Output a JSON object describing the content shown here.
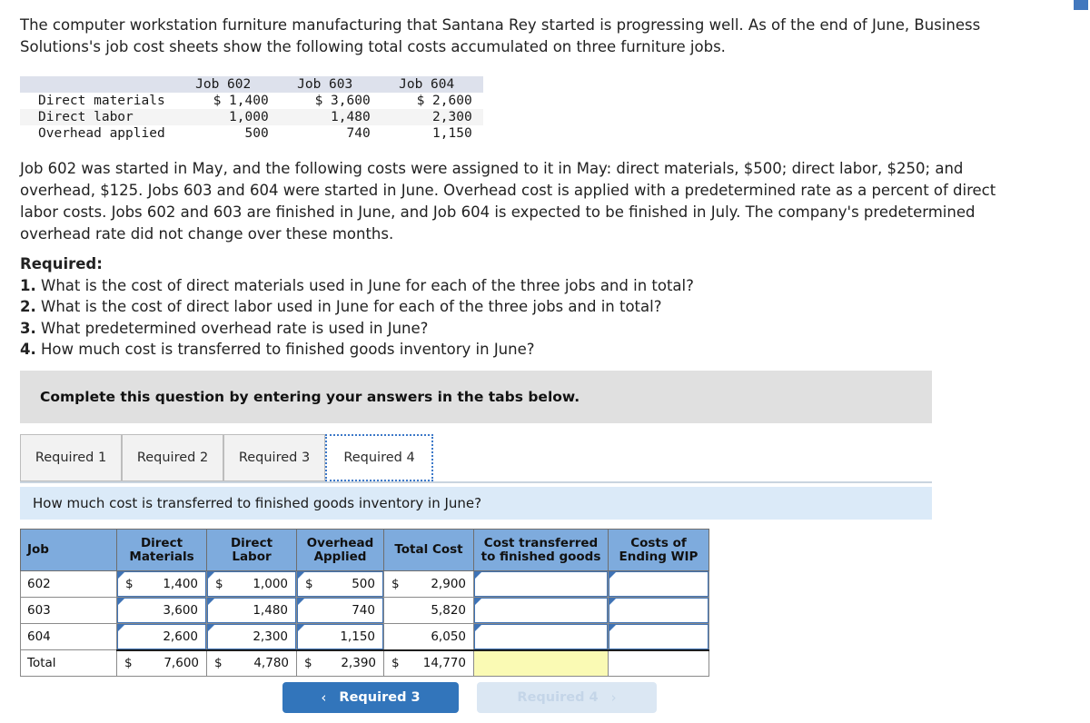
{
  "intro": {
    "paragraph": "The computer workstation furniture manufacturing that Santana Rey started is progressing well. As of the end of June, Business Solutions's job cost sheets show the following total costs accumulated on three furniture jobs."
  },
  "cost_table": {
    "columns": [
      "",
      "Job 602",
      "Job 603",
      "Job 604"
    ],
    "rows": [
      {
        "label": "Direct materials",
        "values": [
          "$ 1,400",
          "$ 3,600",
          "$ 2,600"
        ]
      },
      {
        "label": "Direct labor",
        "values": [
          "1,000",
          "1,480",
          "2,300"
        ]
      },
      {
        "label": "Overhead applied",
        "values": [
          "500",
          "740",
          "1,150"
        ]
      }
    ]
  },
  "body": {
    "paragraph": "Job 602 was started in May, and the following costs were assigned to it in May: direct materials, $500; direct labor, $250; and overhead, $125. Jobs 603 and 604 were started in June. Overhead cost is applied with a predetermined rate as a percent of direct labor costs. Jobs 602 and 603 are finished in June, and Job 604 is expected to be finished in July. The company's predetermined overhead rate did not change over these months."
  },
  "required": {
    "title": "Required:",
    "items": [
      {
        "num": "1.",
        "text": "What is the cost of direct materials used in June for each of the three jobs and in total?"
      },
      {
        "num": "2.",
        "text": "What is the cost of direct labor used in June for each of the three jobs and in total?"
      },
      {
        "num": "3.",
        "text": "What predetermined overhead rate is used in June?"
      },
      {
        "num": "4.",
        "text": "How much cost is transferred to finished goods inventory in June?"
      }
    ]
  },
  "instruction_banner": {
    "text": "Complete this question by entering your answers in the tabs below."
  },
  "tabs": {
    "items": [
      {
        "label": "Required 1",
        "active": false
      },
      {
        "label": "Required 2",
        "active": false
      },
      {
        "label": "Required 3",
        "active": false
      },
      {
        "label": "Required 4",
        "active": true
      }
    ]
  },
  "question_banner": {
    "text": "How much cost is transferred to finished goods inventory in June?"
  },
  "answer_grid": {
    "headers": [
      "Job",
      "Direct Materials",
      "Direct Labor",
      "Overhead Applied",
      "Total Cost",
      "Cost transferred to finished goods",
      "Costs of Ending WIP"
    ],
    "headers_lines": {
      "job": "Job",
      "dm_1": "Direct",
      "dm_2": "Materials",
      "dl_1": "Direct",
      "dl_2": "Labor",
      "oh_1": "Overhead",
      "oh_2": "Applied",
      "tc": "Total Cost",
      "ct_1": "Cost transferred",
      "ct_2": "to finished goods",
      "wip_1": "Costs of",
      "wip_2": "Ending WIP"
    },
    "rows": [
      {
        "job": "602",
        "dm_sym": "$",
        "dm": "1,400",
        "dl_sym": "$",
        "dl": "1,000",
        "oh_sym": "$",
        "oh": "500",
        "tc_sym": "$",
        "tc": "2,900",
        "ct_sym": "",
        "ct": "",
        "wip_sym": "",
        "wip": ""
      },
      {
        "job": "603",
        "dm_sym": "",
        "dm": "3,600",
        "dl_sym": "",
        "dl": "1,480",
        "oh_sym": "",
        "oh": "740",
        "tc_sym": "",
        "tc": "5,820",
        "ct_sym": "",
        "ct": "",
        "wip_sym": "",
        "wip": ""
      },
      {
        "job": "604",
        "dm_sym": "",
        "dm": "2,600",
        "dl_sym": "",
        "dl": "2,300",
        "oh_sym": "",
        "oh": "1,150",
        "tc_sym": "",
        "tc": "6,050",
        "ct_sym": "",
        "ct": "",
        "wip_sym": "",
        "wip": ""
      }
    ],
    "total_row": {
      "job": "Total",
      "dm_sym": "$",
      "dm": "7,600",
      "dl_sym": "$",
      "dl": "4,780",
      "oh_sym": "$",
      "oh": "2,390",
      "tc_sym": "$",
      "tc": "14,770",
      "ct_sym": "",
      "ct": "",
      "wip_sym": "",
      "wip": ""
    }
  },
  "nav": {
    "prev_label": "Required 3",
    "prev_chevron": "‹",
    "next_label": "Required 4",
    "next_chevron": "›"
  },
  "colors": {
    "header_blue": "#7eabdd",
    "banner_blue": "#dbeaf8",
    "banner_gray": "#e0e0e0",
    "input_border": "#3f73b5",
    "highlight_yellow": "#fafab4",
    "button_blue": "#3275bb",
    "button_disabled": "#dbe7f3"
  }
}
